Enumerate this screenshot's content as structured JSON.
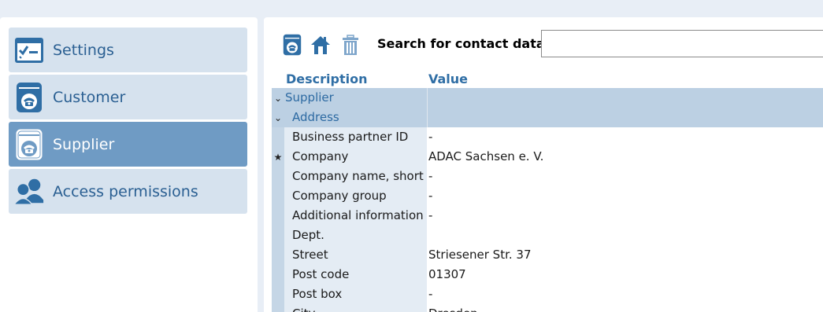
{
  "sidebar": {
    "items": [
      {
        "label": "Settings",
        "icon": "checklist-icon",
        "active": false
      },
      {
        "label": "Customer",
        "icon": "phone-card-icon",
        "active": false
      },
      {
        "label": "Supplier",
        "icon": "phone-card-icon",
        "active": true
      },
      {
        "label": "Access permissions",
        "icon": "users-icon",
        "active": false
      }
    ]
  },
  "toolbar": {
    "icons": [
      "phone-card-icon",
      "home-icon",
      "trash-icon"
    ],
    "search_label": "Search for contact data",
    "search_value": ""
  },
  "table": {
    "headers": {
      "description": "Description",
      "value": "Value"
    },
    "groups": [
      {
        "label": "Supplier",
        "marker": "⌄"
      },
      {
        "label": "Address",
        "marker": "⌄"
      }
    ],
    "rows": [
      {
        "marker": "",
        "description": "Business partner ID",
        "value": "-"
      },
      {
        "marker": "★",
        "description": "Company",
        "value": "ADAC Sachsen e. V."
      },
      {
        "marker": "",
        "description": "Company name, short",
        "value": "-"
      },
      {
        "marker": "",
        "description": "Company group",
        "value": "-"
      },
      {
        "marker": "",
        "description": "Additional information",
        "value": "-"
      },
      {
        "marker": "",
        "description": "Dept.",
        "value": ""
      },
      {
        "marker": "",
        "description": "Street",
        "value": "Striesener Str. 37"
      },
      {
        "marker": "",
        "description": "Post code",
        "value": "01307"
      },
      {
        "marker": "",
        "description": "Post box",
        "value": "-"
      },
      {
        "marker": "",
        "description": "City",
        "value": "Dresden"
      }
    ]
  },
  "colors": {
    "accent": "#2f6ea5",
    "sidebar_item_bg": "#d6e2ee",
    "sidebar_active_bg": "#6f9bc4",
    "group_row_bg": "#bcd0e3"
  }
}
